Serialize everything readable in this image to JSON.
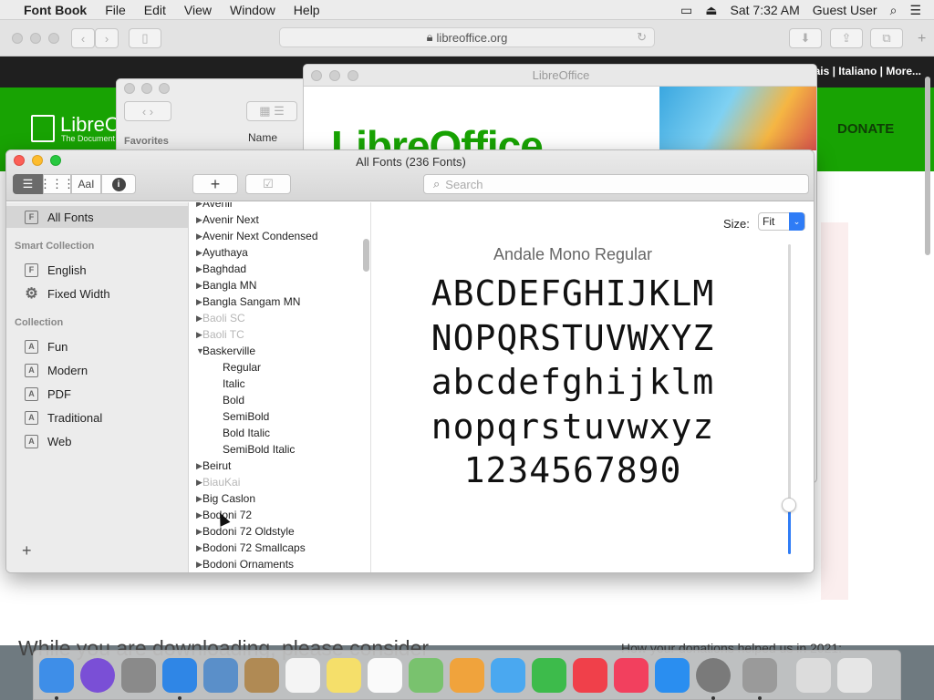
{
  "menubar": {
    "apple": "",
    "app_name": "Font Book",
    "menus": [
      "File",
      "Edit",
      "View",
      "Window",
      "Help"
    ],
    "clock": "Sat 7:32 AM",
    "user": "Guest User"
  },
  "safari": {
    "url": "libreoffice.org",
    "topnav_links": "ançais | Italiano | More...",
    "donate": "DONATE",
    "logo_text": "LibreO",
    "logo_sub": "The Document",
    "heading": "While you are downloading, please consider",
    "donations_note": "How your donations helped us in 2021:"
  },
  "finder": {
    "favorites": "Favorites",
    "name_col": "Name"
  },
  "libreoffice_window": {
    "title": "LibreOffice",
    "splash": "LibreOffice"
  },
  "fontbook": {
    "title": "All Fonts (236 Fonts)",
    "search_placeholder": "Search",
    "view_text_label": "AaI",
    "sidebar": {
      "all_fonts": "All Fonts",
      "smart_collection_header": "Smart Collection",
      "smart_items": [
        "English",
        "Fixed Width"
      ],
      "collection_header": "Collection",
      "collection_items": [
        "Fun",
        "Modern",
        "PDF",
        "Traditional",
        "Web"
      ]
    },
    "fonts": [
      {
        "name": "Avenir",
        "disabled": false
      },
      {
        "name": "Avenir Next",
        "disabled": false
      },
      {
        "name": "Avenir Next Condensed",
        "disabled": false
      },
      {
        "name": "Ayuthaya",
        "disabled": false
      },
      {
        "name": "Baghdad",
        "disabled": false
      },
      {
        "name": "Bangla MN",
        "disabled": false
      },
      {
        "name": "Bangla Sangam MN",
        "disabled": false
      },
      {
        "name": "Baoli SC",
        "disabled": true
      },
      {
        "name": "Baoli TC",
        "disabled": true
      },
      {
        "name": "Baskerville",
        "disabled": false,
        "expanded": true
      },
      {
        "name": "Beirut",
        "disabled": false
      },
      {
        "name": "BiauKai",
        "disabled": true
      },
      {
        "name": "Big Caslon",
        "disabled": false
      },
      {
        "name": "Bodoni 72",
        "disabled": false
      },
      {
        "name": "Bodoni 72 Oldstyle",
        "disabled": false
      },
      {
        "name": "Bodoni 72 Smallcaps",
        "disabled": false
      },
      {
        "name": "Bodoni Ornaments",
        "disabled": false
      }
    ],
    "baskerville_styles": [
      "Regular",
      "Italic",
      "Bold",
      "SemiBold",
      "Bold Italic",
      "SemiBold Italic"
    ],
    "preview": {
      "size_label": "Size:",
      "size_value": "Fit",
      "font_name": "Andale Mono Regular",
      "lines": [
        "ABCDEFGHIJKLM",
        "NOPQRSTUVWXYZ",
        "abcdefghijklm",
        "nopqrstuvwxyz",
        "1234567890"
      ],
      "size_slider_level": 0.15
    }
  },
  "dock": {
    "apps": [
      {
        "name": "Finder",
        "color": "#3e8ee8",
        "running": true
      },
      {
        "name": "Siri",
        "color": "#7a4fd6",
        "running": false
      },
      {
        "name": "Launchpad",
        "color": "#8a8a8a",
        "running": false
      },
      {
        "name": "Safari",
        "color": "#2f86e6",
        "running": true
      },
      {
        "name": "Preview",
        "color": "#5a8fc9",
        "running": false
      },
      {
        "name": "Contacts",
        "color": "#b08a54",
        "running": false
      },
      {
        "name": "Calendar",
        "color": "#f4f4f4",
        "running": false
      },
      {
        "name": "Notes",
        "color": "#f5df6a",
        "running": false
      },
      {
        "name": "Reminders",
        "color": "#fafafa",
        "running": false
      },
      {
        "name": "Maps",
        "color": "#79c26e",
        "running": false
      },
      {
        "name": "Photos",
        "color": "#f0a33c",
        "running": false
      },
      {
        "name": "Messages",
        "color": "#4aa8f0",
        "running": false
      },
      {
        "name": "FaceTime",
        "color": "#3dbb4b",
        "running": false
      },
      {
        "name": "News",
        "color": "#f0404a",
        "running": false
      },
      {
        "name": "Music",
        "color": "#f2405e",
        "running": false
      },
      {
        "name": "App Store",
        "color": "#2a8ef0",
        "running": false
      },
      {
        "name": "System Preferences",
        "color": "#7a7a7a",
        "running": true
      },
      {
        "name": "Font Book",
        "color": "#9a9a9a",
        "running": true
      },
      {
        "name": "Downloads",
        "color": "#dcdcdc",
        "running": false
      },
      {
        "name": "Trash",
        "color": "#e6e6e6",
        "running": false
      }
    ]
  }
}
